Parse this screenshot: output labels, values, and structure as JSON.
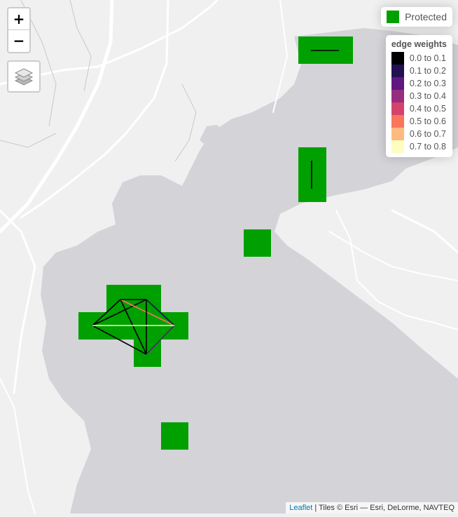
{
  "zoom": {
    "in_label": "+",
    "out_label": "−"
  },
  "layers_control": {
    "icon": "layers-icon"
  },
  "legend_protected": {
    "label": "Protected",
    "color": "#00a000"
  },
  "legend_weights": {
    "title": "edge weights",
    "items": [
      {
        "label": "0.0 to 0.1",
        "color": "#000004"
      },
      {
        "label": "0.1 to 0.2",
        "color": "#221150"
      },
      {
        "label": "0.2 to 0.3",
        "color": "#5f187f"
      },
      {
        "label": "0.3 to 0.4",
        "color": "#982d80"
      },
      {
        "label": "0.4 to 0.5",
        "color": "#d3436e"
      },
      {
        "label": "0.5 to 0.6",
        "color": "#f8765c"
      },
      {
        "label": "0.6 to 0.7",
        "color": "#febb81"
      },
      {
        "label": "0.7 to 0.8",
        "color": "#fcfdbf"
      }
    ]
  },
  "attribution": {
    "link": "Leaflet",
    "text": " | Tiles © Esri — Esri, DeLorme, NAVTEQ"
  },
  "colors": {
    "land": "#f0f0f0",
    "water": "#d4d3d8",
    "road": "#ffffff",
    "protected": "#00a000"
  }
}
